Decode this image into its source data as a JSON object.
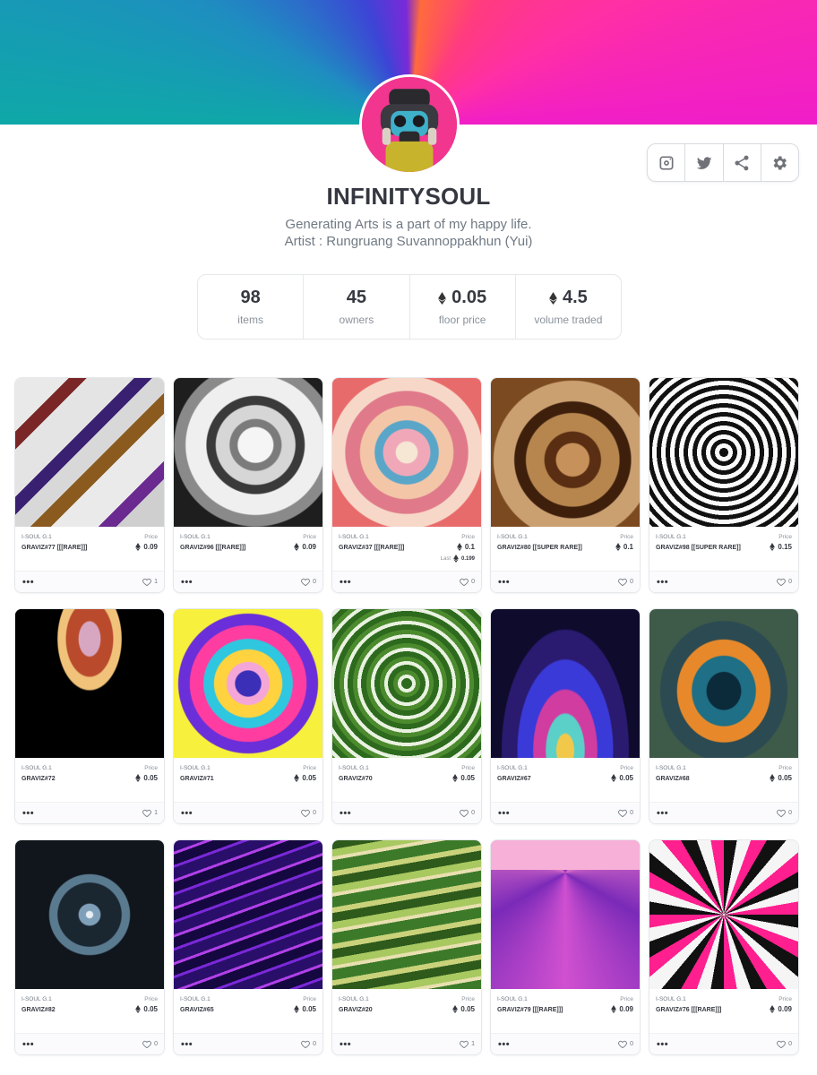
{
  "profile": {
    "name": "INFINITYSOUL",
    "bio_line1": "Generating Arts is a part of my happy life.",
    "bio_line2": "Artist : Rungruang Suvannoppakhun (Yui)"
  },
  "social_icons": [
    "instagram-icon",
    "twitter-icon",
    "share-icon",
    "settings-icon"
  ],
  "stats": {
    "items": {
      "value": "98",
      "label": "items"
    },
    "owners": {
      "value": "45",
      "label": "owners"
    },
    "floor": {
      "value": "0.05",
      "label": "floor price"
    },
    "volume": {
      "value": "4.5",
      "label": "volume traded"
    }
  },
  "card_common": {
    "price_label": "Price",
    "last_label": "Last",
    "more": "•••"
  },
  "cards": [
    {
      "collection": "I-SOUL G.1",
      "name": "GRAVIZ#77 [[[RARE]]]",
      "price": "0.09",
      "likes": "1"
    },
    {
      "collection": "I-SOUL G.1",
      "name": "GRAVIZ#96 [[[RARE]]]",
      "price": "0.09",
      "likes": "0"
    },
    {
      "collection": "I-SOUL G.1",
      "name": "GRAVIZ#37 [[[RARE]]]",
      "price": "0.1",
      "last": "0.199",
      "likes": "0"
    },
    {
      "collection": "I-SOUL G.1",
      "name": "GRAVIZ#80 [[SUPER RARE]]",
      "price": "0.1",
      "likes": "0"
    },
    {
      "collection": "I-SOUL G.1",
      "name": "GRAVIZ#98 [[SUPER RARE]]",
      "price": "0.15",
      "likes": "0"
    },
    {
      "collection": "I-SOUL G.1",
      "name": "GRAVIZ#72",
      "price": "0.05",
      "likes": "1"
    },
    {
      "collection": "I-SOUL G.1",
      "name": "GRAVIZ#71",
      "price": "0.05",
      "likes": "0"
    },
    {
      "collection": "I-SOUL G.1",
      "name": "GRAVIZ#70",
      "price": "0.05",
      "likes": "0"
    },
    {
      "collection": "I-SOUL G.1",
      "name": "GRAVIZ#67",
      "price": "0.05",
      "likes": "0"
    },
    {
      "collection": "I-SOUL G.1",
      "name": "GRAVIZ#68",
      "price": "0.05",
      "likes": "0"
    },
    {
      "collection": "I-SOUL G.1",
      "name": "GRAVIZ#82",
      "price": "0.05",
      "likes": "0"
    },
    {
      "collection": "I-SOUL G.1",
      "name": "GRAVIZ#65",
      "price": "0.05",
      "likes": "0"
    },
    {
      "collection": "I-SOUL G.1",
      "name": "GRAVIZ#20",
      "price": "0.05",
      "likes": "1"
    },
    {
      "collection": "I-SOUL G.1",
      "name": "GRAVIZ#79 [[[RARE]]]",
      "price": "0.09",
      "likes": "0"
    },
    {
      "collection": "I-SOUL G.1",
      "name": "GRAVIZ#76 [[[RARE]]]",
      "price": "0.09",
      "likes": "0"
    }
  ],
  "colors": {
    "text": "#353840",
    "muted": "#707a83",
    "border": "#e5e8eb",
    "avatar_bg": "#f2358f"
  }
}
